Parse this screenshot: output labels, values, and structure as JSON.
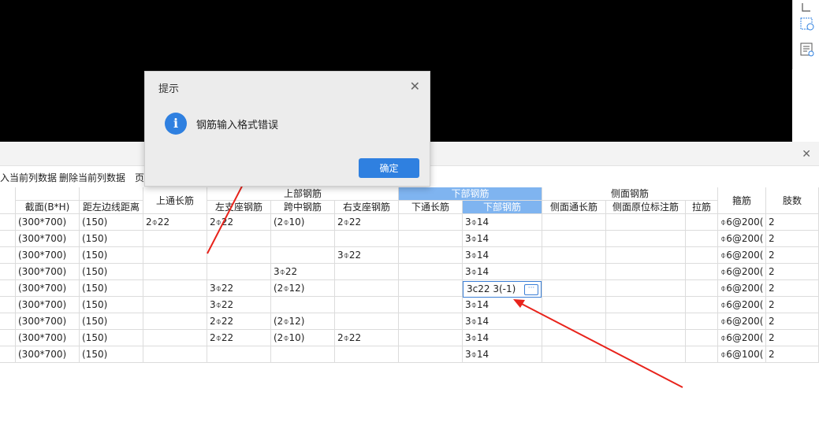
{
  "dialog": {
    "title": "提示",
    "message": "钢筋输入格式错误",
    "ok_label": "确定"
  },
  "toolbar": {
    "items": [
      "入当前列数据",
      "删除当前列数据",
      "页"
    ]
  },
  "table": {
    "group_headers": {
      "top": "上部钢筋",
      "bottom": "下部钢筋",
      "side": "侧面钢筋"
    },
    "headers": {
      "section": "截面(B*H)",
      "edge_distance": "距左边线距离",
      "top_through": "上通长筋",
      "left_support": "左支座钢筋",
      "mid_span": "跨中钢筋",
      "right_support": "右支座钢筋",
      "bottom_through": "下通长筋",
      "bottom_bar": "下部钢筋",
      "side_through": "侧面通长筋",
      "side_orig": "侧面原位标注筋",
      "tie": "拉筋",
      "stirrup": "箍筋",
      "legs": "肢数"
    },
    "rows": [
      [
        "(300*700)",
        "(150)",
        "2⌽22",
        "2⌽22",
        "(2⌽10)",
        "2⌽22",
        "",
        "3⌽14",
        "",
        "",
        "",
        "⌽6@200(",
        "2"
      ],
      [
        "(300*700)",
        "(150)",
        "",
        "",
        "",
        "",
        "",
        "3⌽14",
        "",
        "",
        "",
        "⌽6@200(",
        "2"
      ],
      [
        "(300*700)",
        "(150)",
        "",
        "",
        "",
        "3⌽22",
        "",
        "3⌽14",
        "",
        "",
        "",
        "⌽6@200(",
        "2"
      ],
      [
        "(300*700)",
        "(150)",
        "",
        "",
        "3⌽22",
        "",
        "",
        "3⌽14",
        "",
        "",
        "",
        "⌽6@200(",
        "2"
      ],
      [
        "(300*700)",
        "(150)",
        "",
        "3⌽22",
        "(2⌽12)",
        "",
        "",
        "3c22 3(-1)",
        "",
        "",
        "",
        "⌽6@200(",
        "2"
      ],
      [
        "(300*700)",
        "(150)",
        "",
        "3⌽22",
        "",
        "",
        "",
        "3⌽14",
        "",
        "",
        "",
        "⌽6@200(",
        "2"
      ],
      [
        "(300*700)",
        "(150)",
        "",
        "2⌽22",
        "(2⌽12)",
        "",
        "",
        "3⌽14",
        "",
        "",
        "",
        "⌽6@200(",
        "2"
      ],
      [
        "(300*700)",
        "(150)",
        "",
        "2⌽22",
        "(2⌽10)",
        "2⌽22",
        "",
        "3⌽14",
        "",
        "",
        "",
        "⌽6@200(",
        "2"
      ],
      [
        "(300*700)",
        "(150)",
        "",
        "",
        "",
        "",
        "",
        "3⌽14",
        "",
        "",
        "",
        "⌽6@100(",
        "2"
      ]
    ]
  },
  "colors": {
    "selected_header": "#7fb4f0",
    "accent": "#2f80e0",
    "arrow": "#e8231b"
  },
  "icons": [
    "close-icon",
    "info-icon",
    "ellipsis-icon",
    "panel-close-icon"
  ]
}
